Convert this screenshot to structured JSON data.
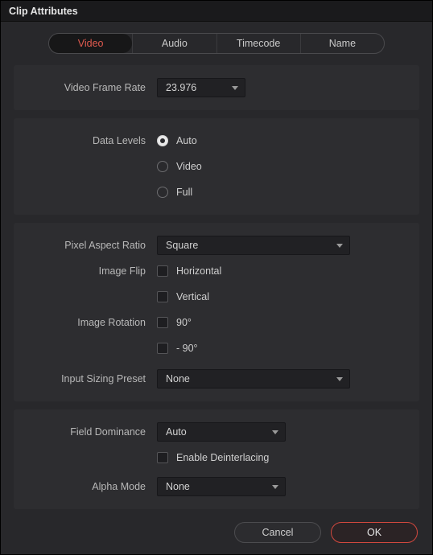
{
  "window": {
    "title": "Clip Attributes"
  },
  "tabs": {
    "video": "Video",
    "audio": "Audio",
    "timecode": "Timecode",
    "name": "Name"
  },
  "videoSection": {
    "frameRateLabel": "Video Frame Rate",
    "frameRateValue": "23.976"
  },
  "dataLevels": {
    "label": "Data Levels",
    "options": {
      "auto": "Auto",
      "video": "Video",
      "full": "Full"
    },
    "selected": "auto"
  },
  "pixel": {
    "parLabel": "Pixel Aspect Ratio",
    "parValue": "Square",
    "flipLabel": "Image Flip",
    "flipH": "Horizontal",
    "flipV": "Vertical",
    "rotLabel": "Image Rotation",
    "rotPlus": " 90°",
    "rotMinus": "- 90°",
    "ispLabel": "Input Sizing Preset",
    "ispValue": "None"
  },
  "field": {
    "domLabel": "Field Dominance",
    "domValue": "Auto",
    "deintLabel": "Enable Deinterlacing",
    "alphaLabel": "Alpha Mode",
    "alphaValue": "None"
  },
  "footer": {
    "cancel": "Cancel",
    "ok": "OK"
  }
}
